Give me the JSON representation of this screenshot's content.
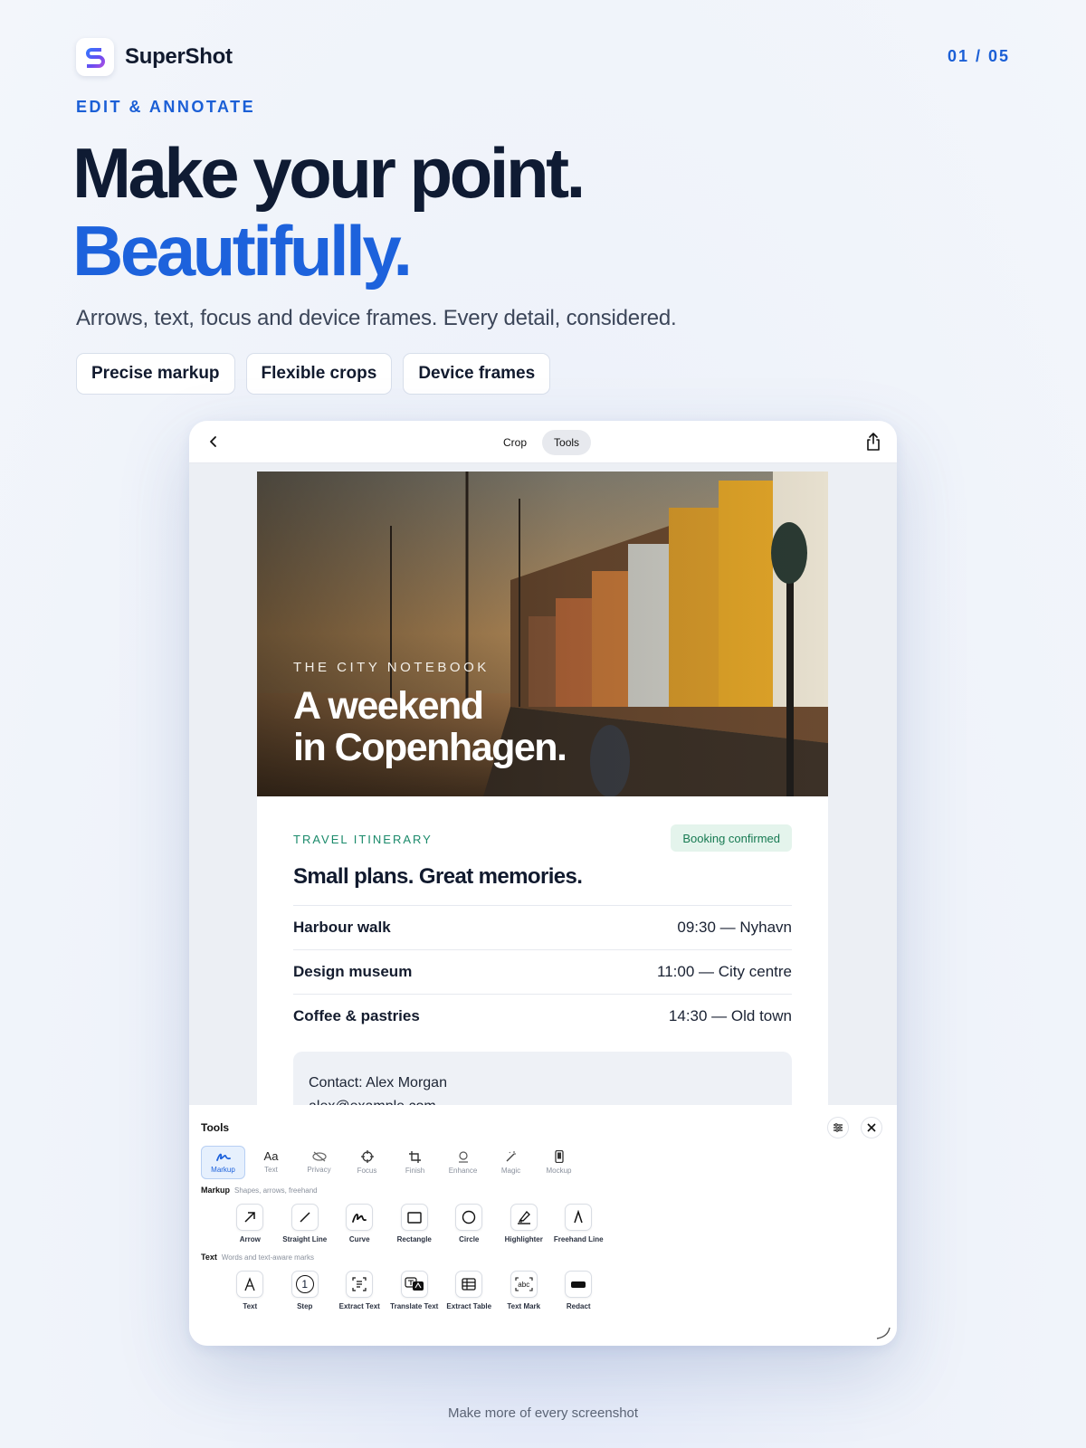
{
  "brand": {
    "name": "SuperShot"
  },
  "pager": "01 / 05",
  "eyebrow": "EDIT & ANNOTATE",
  "headline": {
    "line1": "Make your point.",
    "line2": "Beautifully."
  },
  "subtitle": "Arrows, text, focus and device frames. Every detail, considered.",
  "chips": [
    "Precise markup",
    "Flexible crops",
    "Device frames"
  ],
  "editor": {
    "segments": [
      {
        "label": "Crop",
        "active": false
      },
      {
        "label": "Tools",
        "active": true
      }
    ],
    "document": {
      "hero_eyebrow": "THE CITY NOTEBOOK",
      "hero_title_line1": "A weekend",
      "hero_title_line2": "in Copenhagen.",
      "itinerary_label": "TRAVEL ITINERARY",
      "badge": "Booking confirmed",
      "title": "Small plans. Great memories.",
      "rows": [
        {
          "name": "Harbour walk",
          "time": "09:30 — Nyhavn"
        },
        {
          "name": "Design museum",
          "time": "11:00 — City centre"
        },
        {
          "name": "Coffee & pastries",
          "time": "14:30 — Old town"
        }
      ],
      "contact_line1": "Contact: Alex Morgan",
      "contact_line2": "alex@example.com"
    },
    "tools_panel": {
      "title": "Tools",
      "categories": [
        {
          "label": "Markup",
          "icon": "markup-icon",
          "active": true
        },
        {
          "label": "Text",
          "icon": "text-aa-icon",
          "active": false
        },
        {
          "label": "Privacy",
          "icon": "privacy-icon",
          "active": false
        },
        {
          "label": "Focus",
          "icon": "focus-icon",
          "active": false
        },
        {
          "label": "Finish",
          "icon": "crop-icon",
          "active": false
        },
        {
          "label": "Enhance",
          "icon": "enhance-icon",
          "active": false
        },
        {
          "label": "Magic",
          "icon": "magic-icon",
          "active": false
        },
        {
          "label": "Mockup",
          "icon": "phone-icon",
          "active": false
        }
      ],
      "markup_section": {
        "title": "Markup",
        "desc": "Shapes, arrows, freehand"
      },
      "markup_tools": [
        {
          "label": "Arrow",
          "icon": "arrow-icon"
        },
        {
          "label": "Straight Line",
          "icon": "line-icon"
        },
        {
          "label": "Curve",
          "icon": "curve-icon"
        },
        {
          "label": "Rectangle",
          "icon": "rectangle-icon"
        },
        {
          "label": "Circle",
          "icon": "circle-icon"
        },
        {
          "label": "Highlighter",
          "icon": "highlighter-icon"
        },
        {
          "label": "Freehand Line",
          "icon": "freehand-icon"
        }
      ],
      "text_section": {
        "title": "Text",
        "desc": "Words and text-aware marks"
      },
      "text_tools": [
        {
          "label": "Text",
          "icon": "text-icon"
        },
        {
          "label": "Step",
          "icon": "step-icon",
          "glyph": "1"
        },
        {
          "label": "Extract Text",
          "icon": "extract-text-icon"
        },
        {
          "label": "Translate Text",
          "icon": "translate-icon"
        },
        {
          "label": "Extract Table",
          "icon": "table-icon"
        },
        {
          "label": "Text Mark",
          "icon": "text-mark-icon",
          "glyph": "abc"
        },
        {
          "label": "Redact",
          "icon": "redact-icon"
        }
      ]
    }
  },
  "footer": "Make more of every screenshot",
  "colors": {
    "accent": "#1d62dc",
    "heading": "#0f1b33",
    "success": "#1a8a6a"
  }
}
